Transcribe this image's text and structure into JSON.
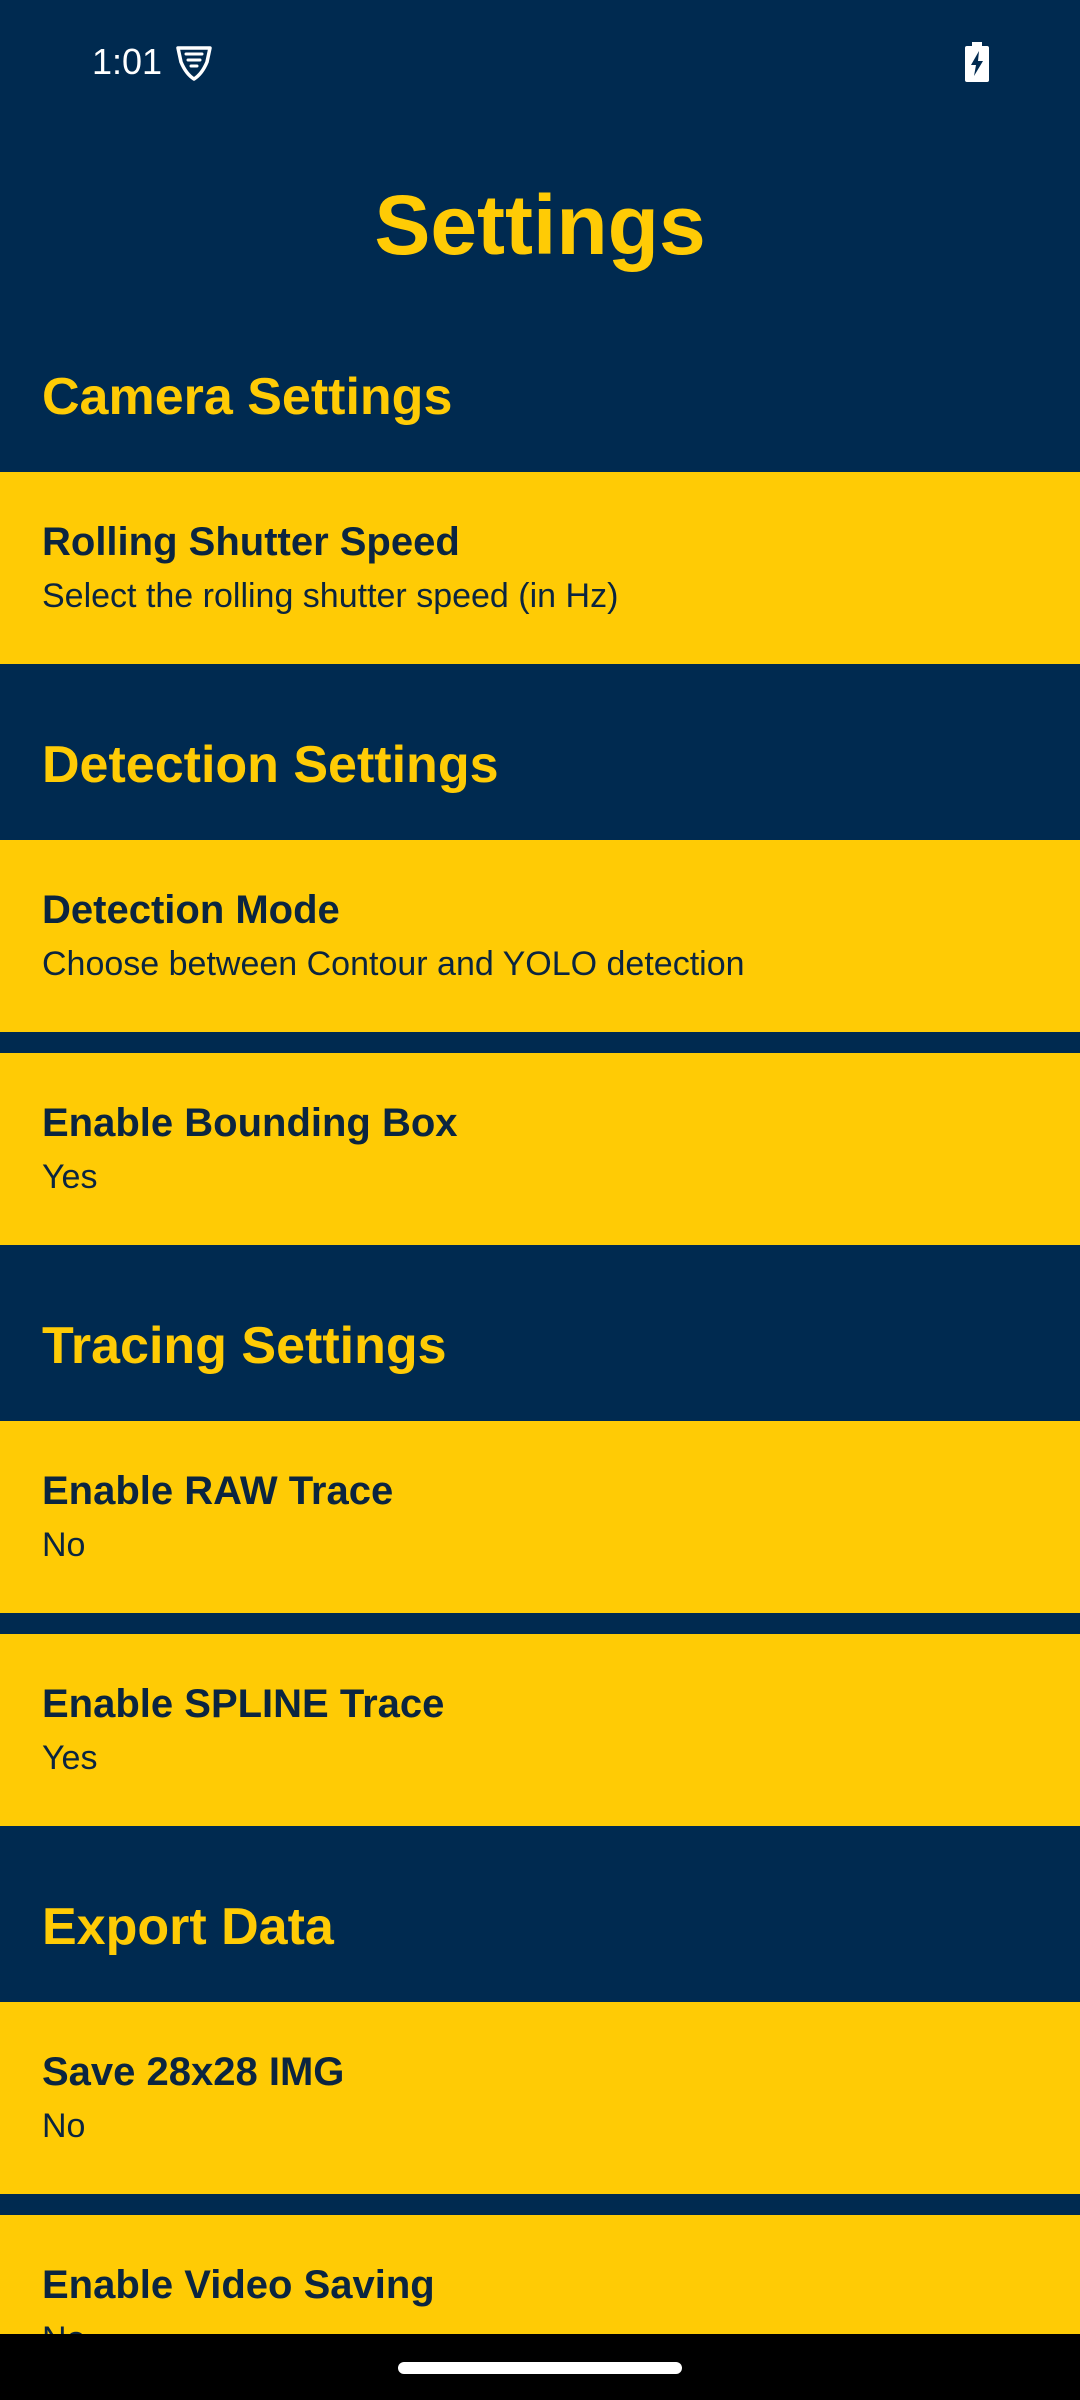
{
  "status_bar": {
    "time": "1:01",
    "vpn_icon": "vpn-key-icon",
    "battery_icon": "battery-charging-icon"
  },
  "page": {
    "title": "Settings"
  },
  "colors": {
    "background": "#002A50",
    "accent": "#FFCB05",
    "item_text": "#0B2540"
  },
  "sections": [
    {
      "header": "Camera Settings",
      "items": [
        {
          "title": "Rolling Shutter Speed",
          "summary": "Select the rolling shutter speed (in Hz)"
        }
      ]
    },
    {
      "header": "Detection Settings",
      "items": [
        {
          "title": "Detection Mode",
          "summary": "Choose between Contour and YOLO detection"
        },
        {
          "title": "Enable Bounding Box",
          "summary": "Yes"
        }
      ]
    },
    {
      "header": "Tracing Settings",
      "items": [
        {
          "title": "Enable RAW Trace",
          "summary": "No"
        },
        {
          "title": "Enable SPLINE Trace",
          "summary": "Yes"
        }
      ]
    },
    {
      "header": "Export Data",
      "items": [
        {
          "title": "Save 28x28 IMG",
          "summary": "No"
        },
        {
          "title": "Enable Video Saving",
          "summary": "No"
        }
      ]
    }
  ]
}
